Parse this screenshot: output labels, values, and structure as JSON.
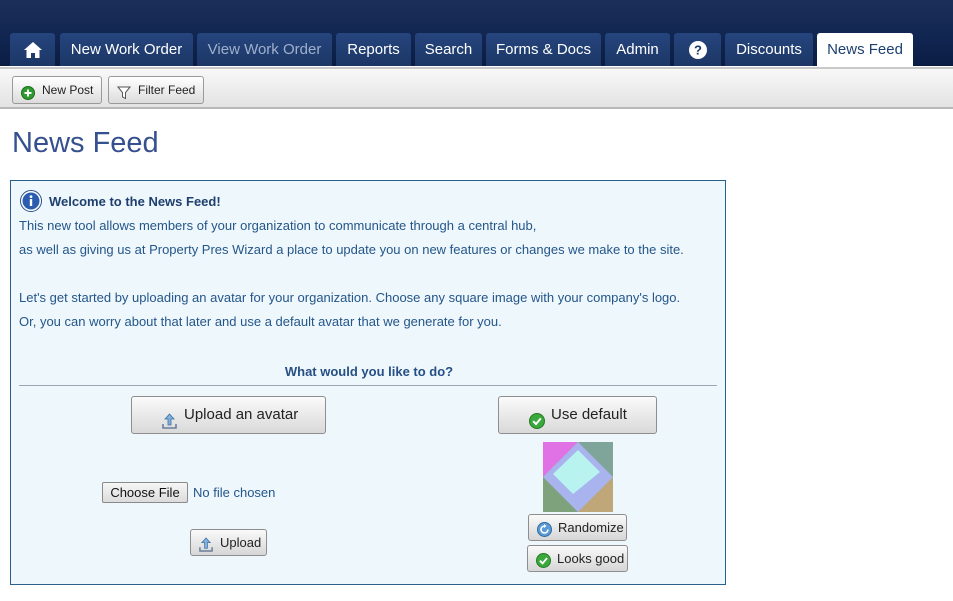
{
  "nav": {
    "home_icon": "home-icon",
    "help_icon": "question-circle-icon",
    "tabs": [
      {
        "label": "New Work Order"
      },
      {
        "label": "View Work Order"
      },
      {
        "label": "Reports"
      },
      {
        "label": "Search"
      },
      {
        "label": "Forms & Docs"
      },
      {
        "label": "Admin"
      },
      {
        "label": "Discounts"
      },
      {
        "label": "News Feed"
      }
    ],
    "active_tab": "News Feed",
    "colors": {
      "bar": "#102550",
      "tab": "#1c3766",
      "active_tab": "#ffffff"
    }
  },
  "toolbar": {
    "new_post": "New Post",
    "filter_feed": "Filter Feed"
  },
  "page": {
    "title": "News Feed"
  },
  "panel": {
    "heading": "Welcome to the News Feed!",
    "lines": [
      "This new tool allows members of your organization to communicate through a central hub,",
      "as well as giving us at Property Pres Wizard a place to update you on new features or changes we make to the site.",
      "Let's get started by uploading an avatar for your organization. Choose any square image with your company's logo.",
      "Or, you can worry about that later and use a default avatar that we generate for you."
    ],
    "question": "What would you like to do?",
    "upload_avatar": "Upload an avatar",
    "use_default": "Use default",
    "choose_file": "Choose File",
    "file_status": "No file chosen",
    "upload": "Upload",
    "randomize": "Randomize",
    "looks_good": "Looks good",
    "colors": {
      "panel_bg": "#eef7fc",
      "panel_border": "#2b5f8c",
      "text": "#24568a"
    }
  }
}
